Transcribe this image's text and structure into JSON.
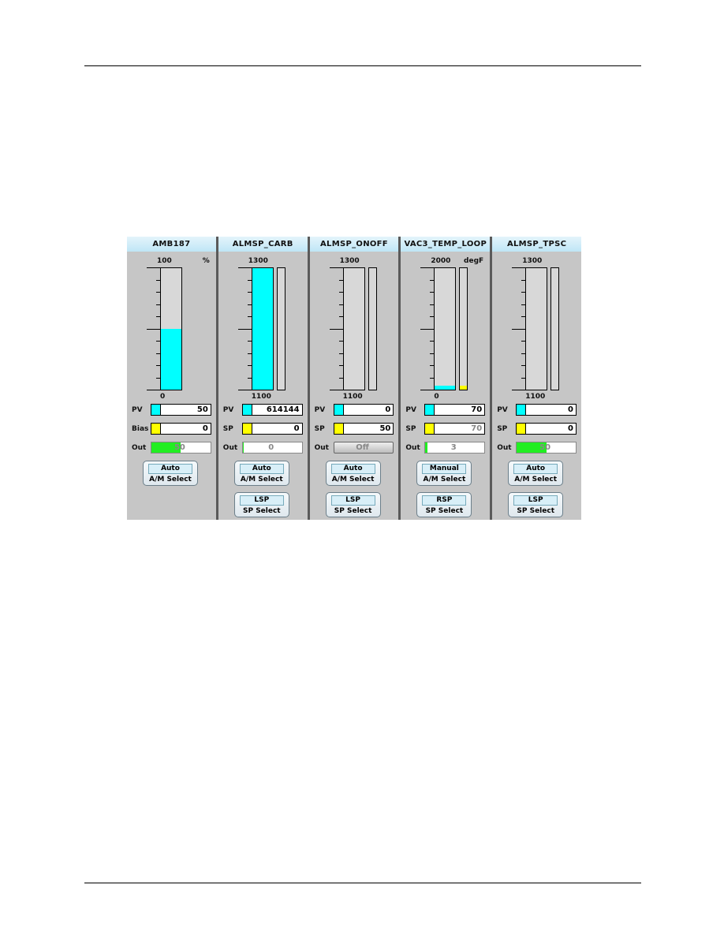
{
  "loops": [
    {
      "name": "AMB187",
      "scale_max": "100",
      "scale_min": "0",
      "units": "%",
      "bar_fraction": 0.5,
      "sp_bar": false,
      "sp_fraction": 0,
      "rows": [
        {
          "label": "PV",
          "value": "50",
          "swatch": "#00ffff",
          "kind": "value"
        },
        {
          "label": "Bias",
          "value": "0",
          "swatch": "#ffff00",
          "kind": "value"
        },
        {
          "label": "Out",
          "value": "50",
          "kind": "out",
          "out_fraction": 0.5
        }
      ],
      "buttons": [
        {
          "state": "Auto",
          "label": "A/M Select"
        }
      ]
    },
    {
      "name": "ALMSP_CARB",
      "scale_max": "1300",
      "scale_min": "1100",
      "units": "",
      "bar_fraction": 1.0,
      "sp_bar": true,
      "sp_fraction": 0,
      "rows": [
        {
          "label": "PV",
          "value": "614144",
          "swatch": "#00ffff",
          "kind": "value"
        },
        {
          "label": "SP",
          "value": "0",
          "swatch": "#ffff00",
          "kind": "value"
        },
        {
          "label": "Out",
          "value": "0",
          "kind": "out",
          "out_fraction": 0.0
        }
      ],
      "buttons": [
        {
          "state": "Auto",
          "label": "A/M Select"
        },
        {
          "state": "LSP",
          "label": "SP Select"
        }
      ]
    },
    {
      "name": "ALMSP_ONOFF",
      "scale_max": "1300",
      "scale_min": "1100",
      "units": "",
      "bar_fraction": 0,
      "sp_bar": true,
      "sp_fraction": 0,
      "rows": [
        {
          "label": "PV",
          "value": "0",
          "swatch": "#00ffff",
          "kind": "value"
        },
        {
          "label": "SP",
          "value": "50",
          "swatch": "#ffff00",
          "kind": "value"
        },
        {
          "label": "Out",
          "value": "Off",
          "kind": "off"
        }
      ],
      "buttons": [
        {
          "state": "Auto",
          "label": "A/M Select"
        },
        {
          "state": "LSP",
          "label": "SP Select"
        }
      ]
    },
    {
      "name": "VAC3_TEMP_LOOP",
      "scale_max": "2000",
      "scale_min": "0",
      "units": "degF",
      "bar_fraction": 0.035,
      "sp_bar": true,
      "sp_fraction": 0.035,
      "rows": [
        {
          "label": "PV",
          "value": "70",
          "swatch": "#00ffff",
          "kind": "value"
        },
        {
          "label": "SP",
          "value": "70",
          "swatch": "#ffff00",
          "kind": "value-gray"
        },
        {
          "label": "Out",
          "value": "3",
          "kind": "out",
          "out_fraction": 0.03
        }
      ],
      "buttons": [
        {
          "state": "Manual",
          "label": "A/M Select"
        },
        {
          "state": "RSP",
          "label": "SP Select"
        }
      ]
    },
    {
      "name": "ALMSP_TPSC",
      "scale_max": "1300",
      "scale_min": "1100",
      "units": "",
      "bar_fraction": 0,
      "sp_bar": true,
      "sp_fraction": 0,
      "rows": [
        {
          "label": "PV",
          "value": "0",
          "swatch": "#00ffff",
          "kind": "value"
        },
        {
          "label": "SP",
          "value": "0",
          "swatch": "#ffff00",
          "kind": "value"
        },
        {
          "label": "Out",
          "value": "50",
          "kind": "out",
          "out_fraction": 0.5
        }
      ],
      "buttons": [
        {
          "state": "Auto",
          "label": "A/M Select"
        },
        {
          "state": "LSP",
          "label": "SP Select"
        }
      ]
    }
  ],
  "colors": {
    "pv": "#00ffff",
    "sp": "#ffff00",
    "out": "#22ee22"
  }
}
